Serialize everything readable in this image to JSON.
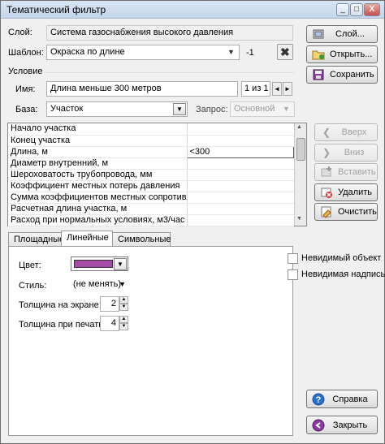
{
  "window": {
    "title": "Тематический фильтр",
    "controls": [
      "_",
      "□",
      "X"
    ]
  },
  "layer": {
    "label": "Слой:",
    "value": "Система газоснабжения высокого давления",
    "button": "Слой..."
  },
  "template": {
    "label": "Шаблон:",
    "value": "Окраска по длине",
    "index": "-1",
    "open_button": "Открыть...",
    "save_button": "Сохранить"
  },
  "condition": {
    "group_label": "Условие",
    "name_label": "Имя:",
    "name_value": "Длина меньше 300 метров",
    "counter": "1 из 1",
    "base_label": "База:",
    "base_value": "Участок",
    "query_label": "Запрос:",
    "query_value": "Основной"
  },
  "properties": [
    {
      "name": "Начало участка",
      "value": ""
    },
    {
      "name": "Конец участка",
      "value": ""
    },
    {
      "name": "Длина, м",
      "value": "<300"
    },
    {
      "name": "Диаметр внутренний, м",
      "value": ""
    },
    {
      "name": "Шероховатость трубопровода, мм",
      "value": ""
    },
    {
      "name": "Коэффициент местных потерь давления",
      "value": ""
    },
    {
      "name": "Сумма коэффициентов местных сопротивлен...",
      "value": ""
    },
    {
      "name": "Расчетная длина участка, м",
      "value": ""
    },
    {
      "name": "Расход при нормальных условиях, м3/час",
      "value": ""
    }
  ],
  "side_buttons": {
    "up": "Вверх",
    "down": "Вниз",
    "insert": "Вставить",
    "delete": "Удалить",
    "clear": "Очистить"
  },
  "tabs": [
    "Площадные",
    "Линейные",
    "Символьные"
  ],
  "line_style": {
    "color_label": "Цвет:",
    "color_value": "#a64ca6",
    "style_label": "Стиль:",
    "style_value": "(не менять)",
    "screen_width_label": "Толщина на экране:",
    "screen_width_value": "2",
    "print_width_label": "Толщина при печати:",
    "print_width_value": "4"
  },
  "options": {
    "invisible_object": "Невидимый объект",
    "invisible_label": "Невидимая надпись"
  },
  "footer": {
    "help": "Справка",
    "close": "Закрыть"
  },
  "icons": {
    "layer": "layers-icon",
    "open": "open-folder-icon",
    "save": "floppy-disk-icon",
    "clear_template": "x-icon",
    "up": "chevron-left-icon",
    "down": "chevron-right-icon",
    "insert": "insert-icon",
    "delete": "delete-icon",
    "clear": "eraser-icon",
    "help": "help-icon",
    "close": "exit-icon"
  }
}
